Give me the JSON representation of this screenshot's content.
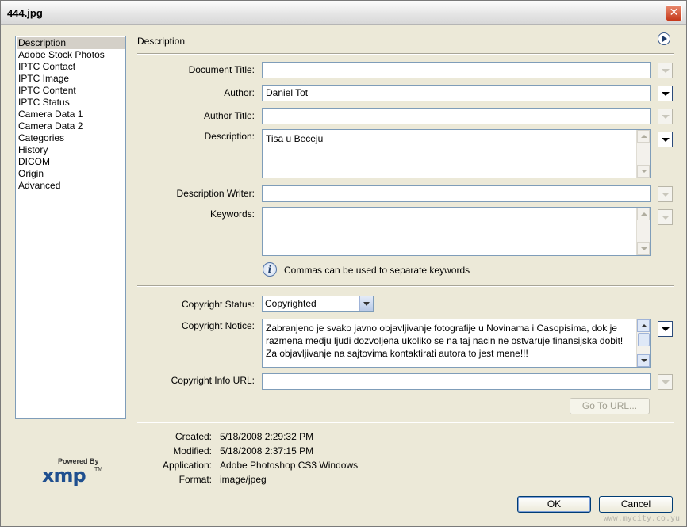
{
  "window": {
    "title": "444.jpg",
    "close_glyph": "✕"
  },
  "sidebar": {
    "items": [
      {
        "label": "Description",
        "selected": true
      },
      {
        "label": "Adobe Stock Photos"
      },
      {
        "label": "IPTC Contact"
      },
      {
        "label": "IPTC Image"
      },
      {
        "label": "IPTC Content"
      },
      {
        "label": "IPTC Status"
      },
      {
        "label": "Camera Data 1"
      },
      {
        "label": "Camera Data 2"
      },
      {
        "label": "Categories"
      },
      {
        "label": "History"
      },
      {
        "label": "DICOM"
      },
      {
        "label": "Origin"
      },
      {
        "label": "Advanced"
      }
    ]
  },
  "logo": {
    "powered_by": "Powered By",
    "word": "xmp",
    "tm": "TM"
  },
  "panel": {
    "title": "Description",
    "fields": {
      "document_title": {
        "label": "Document Title:",
        "value": ""
      },
      "author": {
        "label": "Author:",
        "value": "Daniel Tot"
      },
      "author_title": {
        "label": "Author Title:",
        "value": ""
      },
      "description": {
        "label": "Description:",
        "value": "Tisa u Beceju"
      },
      "description_writer": {
        "label": "Description Writer:",
        "value": ""
      },
      "keywords": {
        "label": "Keywords:",
        "value": ""
      },
      "keywords_hint": "Commas can be used to separate keywords",
      "copyright_status": {
        "label": "Copyright Status:",
        "value": "Copyrighted"
      },
      "copyright_notice": {
        "label": "Copyright Notice:",
        "value": "Zabranjeno je svako javno objavljivanje fotografije u Novinama i Casopisima, dok je razmena medju ljudi dozvoljena ukoliko se na taj nacin ne ostvaruje finansijska dobit! Za objavljivanje na sajtovima kontaktirati autora to jest mene!!!"
      },
      "copyright_url": {
        "label": "Copyright Info URL:",
        "value": ""
      }
    },
    "go_to_url": "Go To URL..."
  },
  "metadata": {
    "created_label": "Created:",
    "created": "5/18/2008 2:29:32 PM",
    "modified_label": "Modified:",
    "modified": "5/18/2008 2:37:15 PM",
    "application_label": "Application:",
    "application": "Adobe Photoshop CS3 Windows",
    "format_label": "Format:",
    "format": "image/jpeg"
  },
  "buttons": {
    "ok": "OK",
    "cancel": "Cancel"
  },
  "watermark": "www.mycity.co.yu"
}
